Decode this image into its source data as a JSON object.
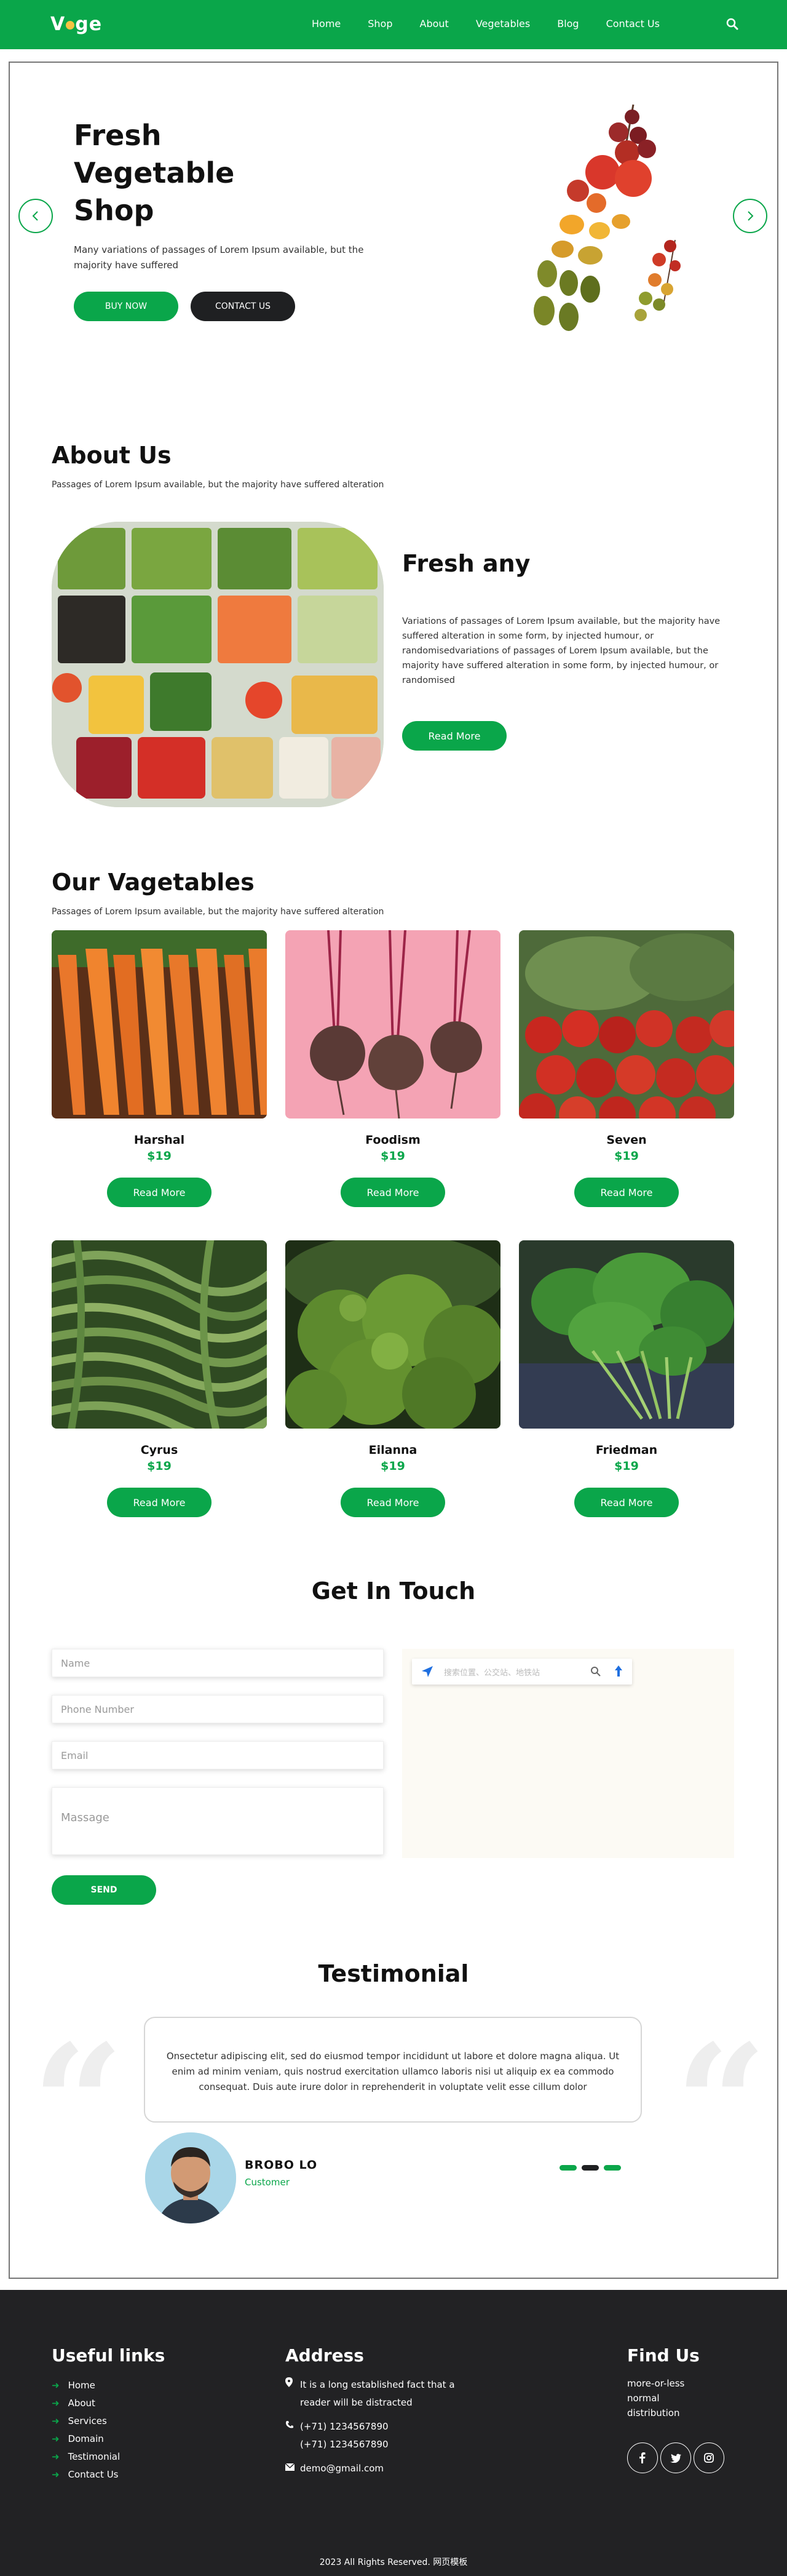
{
  "header": {
    "logo": "Vege",
    "nav": [
      "Home",
      "Shop",
      "About",
      "Vegetables",
      "Blog",
      "Contact Us"
    ]
  },
  "hero": {
    "title": "Fresh Vegetable Shop",
    "text": "Many variations of passages of Lorem Ipsum available, but the majority have suffered",
    "buy_label": "BUY NOW",
    "contact_label": "CONTACT US"
  },
  "about": {
    "title": "About Us",
    "subtitle": "Passages of Lorem Ipsum available, but the majority have suffered alteration",
    "heading": "Fresh any",
    "text": "Variations of passages of Lorem Ipsum available, but the majority have suffered alteration in some form, by injected humour, or randomisedvariations of passages of Lorem Ipsum available, but the majority have suffered alteration in some form, by injected humour, or randomised",
    "button": "Read More"
  },
  "vegetables": {
    "title": "Our Vagetables",
    "subtitle": "Passages of Lorem Ipsum available, but the majority have suffered alteration",
    "items": [
      {
        "name": "Harshal",
        "price": "$19",
        "button": "Read More"
      },
      {
        "name": "Foodism",
        "price": "$19",
        "button": "Read More"
      },
      {
        "name": "Seven",
        "price": "$19",
        "button": "Read More"
      },
      {
        "name": "Cyrus",
        "price": "$19",
        "button": "Read More"
      },
      {
        "name": "Eilanna",
        "price": "$19",
        "button": "Read More"
      },
      {
        "name": "Friedman",
        "price": "$19",
        "button": "Read More"
      }
    ]
  },
  "contact": {
    "title": "Get In Touch",
    "name_placeholder": "Name",
    "phone_placeholder": "Phone Number",
    "email_placeholder": "Email",
    "message_placeholder": "Massage",
    "send_label": "SEND",
    "map_search_placeholder": "搜索位置、公交站、地铁站"
  },
  "testimonial": {
    "title": "Testimonial",
    "quote": "Onsectetur adipiscing elit, sed do eiusmod tempor incididunt ut labore et dolore magna aliqua. Ut enim ad minim veniam, quis nostrud exercitation ullamco laboris nisi ut aliquip ex ea commodo consequat. Duis aute irure dolor in reprehenderit in voluptate velit esse cillum dolor",
    "name": "BROBO LO",
    "role": "Customer",
    "active_slide": 2
  },
  "footer": {
    "links_title": "Useful links",
    "links": [
      "Home",
      "About",
      "Services",
      "Domain",
      "Testimonial",
      "Contact Us"
    ],
    "address_title": "Address",
    "address": "It is a long established fact that a reader will be distracted",
    "phone1": "(+71) 1234567890",
    "phone2": "(+71) 1234567890",
    "email": "demo@gmail.com",
    "find_title": "Find Us",
    "find_text": "more-or-less normal distribution",
    "copyright": "2023 All Rights Reserved. 网页模板"
  },
  "colors": {
    "brand": "#0aa64a",
    "dark": "#1f2022",
    "footer_bg": "#222224"
  },
  "icons": [
    "search-icon",
    "arrow-left-icon",
    "arrow-right-icon",
    "location-icon",
    "phone-icon",
    "envelope-icon",
    "facebook-icon",
    "twitter-icon",
    "instagram-icon",
    "quote-icon",
    "paper-plane-icon"
  ]
}
